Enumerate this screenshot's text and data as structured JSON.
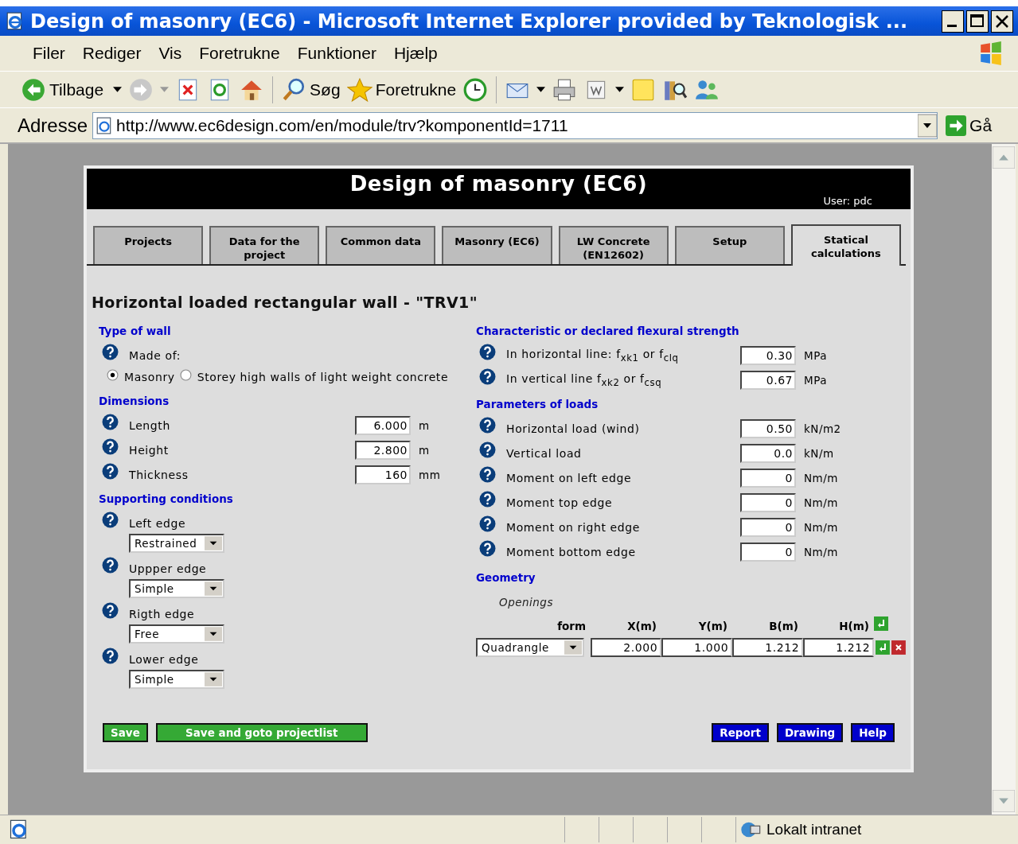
{
  "window": {
    "title": "Design of masonry (EC6) - Microsoft Internet Explorer provided by Teknologisk ..."
  },
  "menu": [
    {
      "label": "Filer"
    },
    {
      "label": "Rediger"
    },
    {
      "label": "Vis"
    },
    {
      "label": "Foretrukne"
    },
    {
      "label": "Funktioner"
    },
    {
      "label": "Hjælp"
    }
  ],
  "toolbar": {
    "back": "Tilbage",
    "search": "Søg",
    "favorites": "Foretrukne"
  },
  "address": {
    "label": "Adresse",
    "url": "http://www.ec6design.com/en/module/trv?komponentId=1711",
    "go": "Gå"
  },
  "app": {
    "title": "Design of masonry (EC6)",
    "user": "User: pdc",
    "tabs": [
      {
        "label": "Projects",
        "selected": false
      },
      {
        "label": "Data for the project",
        "selected": false
      },
      {
        "label": "Common data",
        "selected": false
      },
      {
        "label": "Masonry (EC6)",
        "selected": false
      },
      {
        "label": "LW Concrete (EN12602)",
        "selected": false
      },
      {
        "label": "Setup",
        "selected": false
      },
      {
        "label": "Statical calculations",
        "selected": true
      }
    ],
    "heading": "Horizontal loaded rectangular wall - \"TRV1\"",
    "type_of_wall": {
      "title": "Type of wall",
      "label": "Made of:",
      "options": [
        {
          "label": "Masonry",
          "selected": true
        },
        {
          "label": "Storey high walls of light weight concrete",
          "selected": false
        }
      ]
    },
    "dimensions": {
      "title": "Dimensions",
      "rows": [
        {
          "label": "Length",
          "value": "6.000",
          "unit": "m"
        },
        {
          "label": "Height",
          "value": "2.800",
          "unit": "m"
        },
        {
          "label": "Thickness",
          "value": "160",
          "unit": "mm"
        }
      ]
    },
    "supporting": {
      "title": "Supporting conditions",
      "rows": [
        {
          "label": "Left edge",
          "value": "Restrained"
        },
        {
          "label": "Uppper edge",
          "value": "Simple"
        },
        {
          "label": "Rigth edge",
          "value": "Free"
        },
        {
          "label": "Lower edge",
          "value": "Simple"
        }
      ]
    },
    "strength": {
      "title": "Characteristic or declared flexural strength",
      "rows": [
        {
          "label": "In horizontal line: f$_{xk1}$ or f$_{clq}$",
          "value": "0.30",
          "unit": "MPa"
        },
        {
          "label": "In vertical line f$_{xk2}$ or f$_{csq}$",
          "value": "0.67",
          "unit": "MPa"
        }
      ]
    },
    "loads": {
      "title": "Parameters of loads",
      "rows": [
        {
          "label": "Horizontal load (wind)",
          "value": "0.50",
          "unit": "kN/m2"
        },
        {
          "label": "Vertical load",
          "value": "0.0",
          "unit": "kN/m"
        },
        {
          "label": "Moment on left edge",
          "value": "0",
          "unit": "Nm/m"
        },
        {
          "label": "Moment top edge",
          "value": "0",
          "unit": "Nm/m"
        },
        {
          "label": "Moment on right edge",
          "value": "0",
          "unit": "Nm/m"
        },
        {
          "label": "Moment bottom edge",
          "value": "0",
          "unit": "Nm/m"
        }
      ]
    },
    "geometry": {
      "title": "Geometry",
      "subtitle": "Openings",
      "columns": [
        "form",
        "X(m)",
        "Y(m)",
        "B(m)",
        "H(m)"
      ],
      "rows": [
        {
          "form": "Quadrangle",
          "values": [
            "2.000",
            "1.000",
            "1.212",
            "1.212"
          ]
        }
      ]
    },
    "buttons": [
      {
        "label": "Save",
        "kind": "save"
      },
      {
        "label": "Save and goto projectlist",
        "kind": "save"
      },
      {
        "label": "Report",
        "kind": "nav"
      },
      {
        "label": "Drawing",
        "kind": "nav"
      },
      {
        "label": "Help",
        "kind": "nav"
      }
    ]
  },
  "status_bar": {
    "zone": "Lokalt intranet"
  }
}
